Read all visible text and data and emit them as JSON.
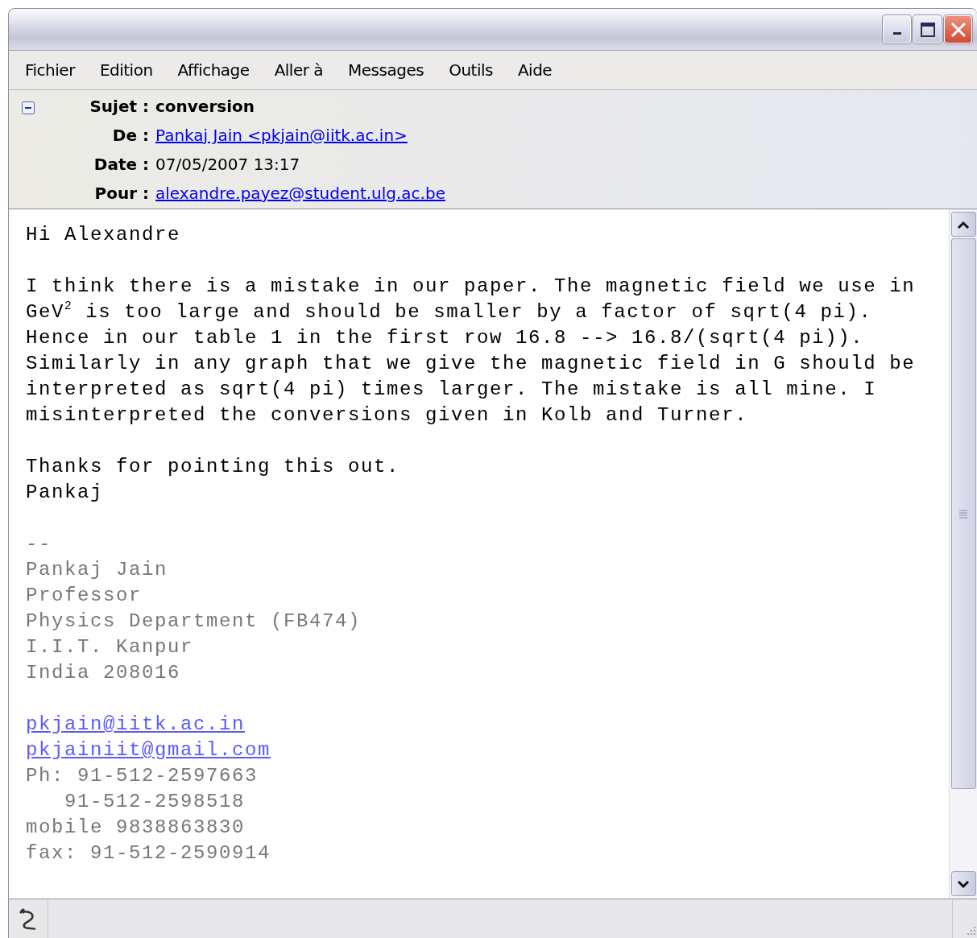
{
  "menu": [
    "Fichier",
    "Edition",
    "Affichage",
    "Aller à",
    "Messages",
    "Outils",
    "Aide"
  ],
  "header": {
    "expanded": true,
    "fields": [
      {
        "label": "Sujet :",
        "value": "conversion",
        "kind": "bold"
      },
      {
        "label": "De :",
        "value": "Pankaj Jain <pkjain@iitk.ac.in>",
        "kind": "link"
      },
      {
        "label": "Date :",
        "value": "07/05/2007 13:17",
        "kind": "text"
      },
      {
        "label": "Pour :",
        "value": "alexandre.payez@student.ulg.ac.be",
        "kind": "link"
      }
    ]
  },
  "body": [
    {
      "kind": "normal",
      "lines": [
        {
          "text": "Hi Alexandre",
          "kind": "text"
        }
      ]
    },
    {
      "kind": "normal",
      "lines": [
        {
          "text": "I think there is a mistake in our paper. The magnetic field we use in",
          "kind": "text"
        },
        {
          "text": "GeV$^{2}$ is too large and should be smaller by a factor of sqrt(4 pi).",
          "kind": "text"
        },
        {
          "text": "Hence in our table 1 in the first row 16.8 --> 16.8/(sqrt(4 pi)).",
          "kind": "text"
        },
        {
          "text": "Similarly in any graph that we give the magnetic field in G should be",
          "kind": "text"
        },
        {
          "text": "interpreted as sqrt(4 pi) times larger. The mistake is all mine. I",
          "kind": "text"
        },
        {
          "text": "misinterpreted the conversions given in Kolb and Turner.",
          "kind": "text"
        }
      ]
    },
    {
      "kind": "normal",
      "lines": [
        {
          "text": "Thanks for pointing this out.",
          "kind": "text"
        },
        {
          "text": "Pankaj",
          "kind": "text"
        }
      ]
    },
    {
      "kind": "signature",
      "lines": [
        {
          "text": "--",
          "kind": "text"
        },
        {
          "text": "Pankaj Jain",
          "kind": "text"
        },
        {
          "text": "Professor",
          "kind": "text"
        },
        {
          "text": "Physics Department (FB474)",
          "kind": "text"
        },
        {
          "text": "I.I.T. Kanpur",
          "kind": "text"
        },
        {
          "text": "India 208016",
          "kind": "text"
        }
      ]
    },
    {
      "kind": "signature",
      "lines": [
        {
          "text": "pkjain@iitk.ac.in",
          "kind": "link"
        },
        {
          "text": "pkjainiit@gmail.com",
          "kind": "link"
        },
        {
          "text": "Ph: 91-512-2597663",
          "kind": "text"
        },
        {
          "text": "   91-512-2598518",
          "kind": "text"
        },
        {
          "text": "mobile 9838863830",
          "kind": "text"
        },
        {
          "text": "fax: 91-512-2590914",
          "kind": "text"
        }
      ]
    }
  ]
}
